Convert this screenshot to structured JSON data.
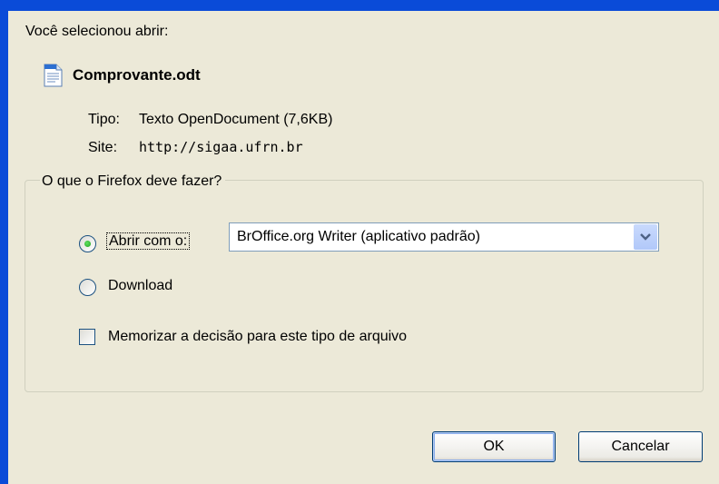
{
  "dialog": {
    "intro": "Você selecionou abrir:",
    "file": {
      "name": "Comprovante.odt",
      "icon": "document-icon"
    },
    "type_label": "Tipo:",
    "type_value": "Texto OpenDocument (7,6KB)",
    "site_label": "Site:",
    "site_value": "http://sigaa.ufrn.br"
  },
  "action": {
    "legend": "O que o Firefox deve fazer?",
    "open_with_label": "Abrir com o:",
    "open_with_selected": true,
    "app_select_value": "BrOffice.org Writer (aplicativo padrão)",
    "download_label": "Download",
    "download_selected": false,
    "remember_label": "Memorizar a decisão para este tipo de arquivo",
    "remember_checked": false
  },
  "buttons": {
    "ok": "OK",
    "cancel": "Cancelar"
  },
  "colors": {
    "title_bar": "#0a4bd8",
    "dialog_bg": "#ece9d8",
    "radio_dot": "#21a121"
  }
}
